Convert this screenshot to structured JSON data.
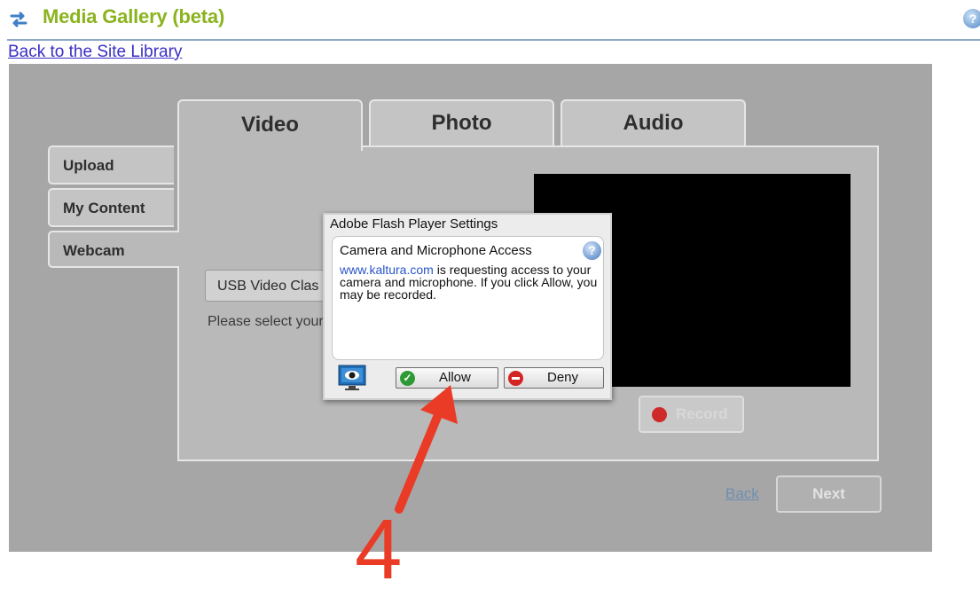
{
  "header": {
    "title": "Media Gallery (beta)",
    "back_link": "Back to the Site Library",
    "help": "?"
  },
  "tabs": [
    {
      "label": "Video",
      "active": true
    },
    {
      "label": "Photo",
      "active": false
    },
    {
      "label": "Audio",
      "active": false
    }
  ],
  "sidebar": {
    "items": [
      {
        "label": "Upload",
        "active": false
      },
      {
        "label": "My Content",
        "active": false
      },
      {
        "label": "Webcam",
        "active": true
      }
    ]
  },
  "webcam": {
    "device_value": "USB Video Clas",
    "prompt": "Please select your",
    "record_label": "Record"
  },
  "nav": {
    "back_label": "Back",
    "next_label": "Next"
  },
  "flash_dialog": {
    "title": "Adobe Flash Player Settings",
    "heading": "Camera and Microphone Access",
    "help": "?",
    "site": "www.kaltura.com",
    "message": " is requesting access to your camera and microphone. If you click Allow, you may be recorded.",
    "allow_label": "Allow",
    "deny_label": "Deny"
  },
  "annotation": {
    "step": "4"
  },
  "colors": {
    "title_green": "#8ab31e",
    "link_blue": "#3a2fc4",
    "panel_gray": "#a6a6a6",
    "arrow_red": "#ea3b26"
  }
}
